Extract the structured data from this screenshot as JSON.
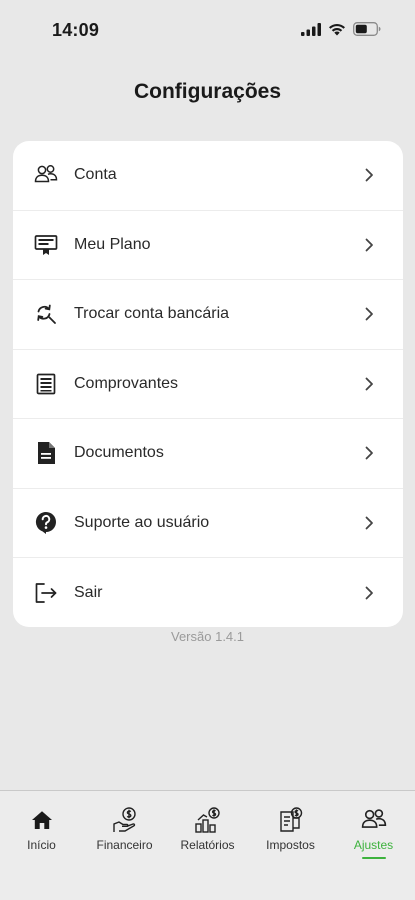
{
  "status_bar": {
    "time": "14:09",
    "icons": [
      "signal-icon",
      "wifi-icon",
      "battery-icon"
    ]
  },
  "header": {
    "title": "Configurações"
  },
  "settings": {
    "items": [
      {
        "label": "Conta",
        "icon": "users-icon"
      },
      {
        "label": "Meu Plano",
        "icon": "certificate-icon"
      },
      {
        "label": "Trocar conta bancária",
        "icon": "search-refresh-icon"
      },
      {
        "label": "Comprovantes",
        "icon": "receipt-icon"
      },
      {
        "label": "Documentos",
        "icon": "document-icon"
      },
      {
        "label": "Suporte ao usuário",
        "icon": "help-icon"
      },
      {
        "label": "Sair",
        "icon": "logout-icon"
      }
    ]
  },
  "footer": {
    "version": "Versão 1.4.1"
  },
  "bottom_nav": {
    "items": [
      {
        "label": "Início",
        "icon": "home-icon"
      },
      {
        "label": "Financeiro",
        "icon": "finance-icon"
      },
      {
        "label": "Relatórios",
        "icon": "reports-icon"
      },
      {
        "label": "Impostos",
        "icon": "taxes-icon"
      },
      {
        "label": "Ajustes",
        "icon": "settings-users-icon",
        "active": true
      }
    ]
  },
  "colors": {
    "background": "#e8e8e8",
    "card": "#ffffff",
    "accent": "#3db23d",
    "text": "#1a1a1a",
    "muted": "#9a9a9a"
  }
}
